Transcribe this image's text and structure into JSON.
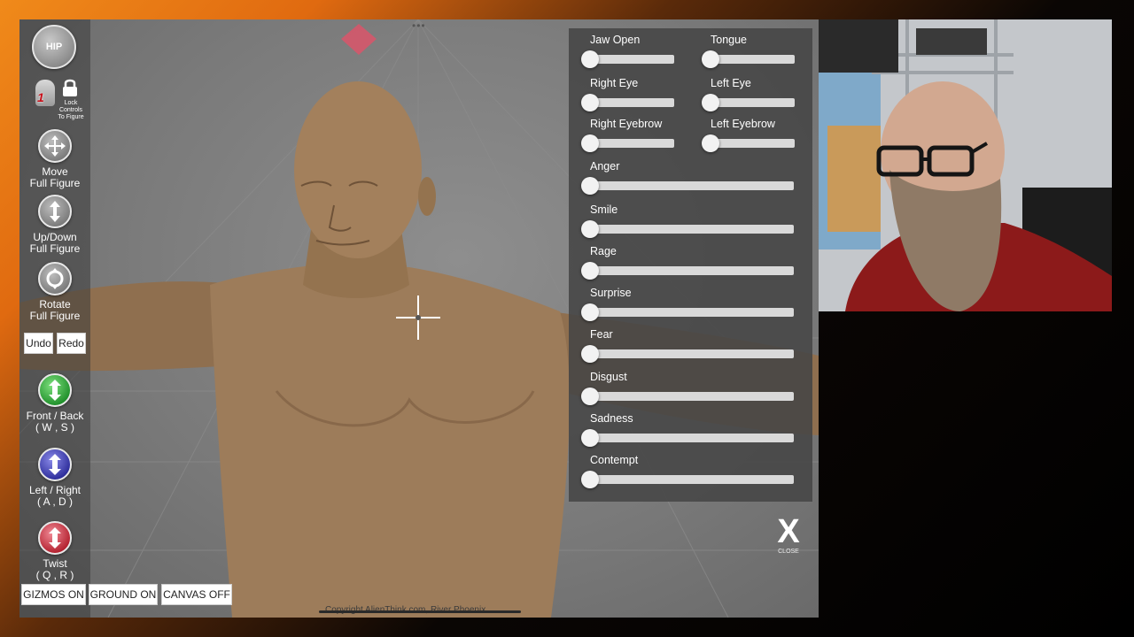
{
  "sidebar": {
    "hip_label": "HIP",
    "lock_label_line1": "Lock",
    "lock_label_line2": "Controls",
    "lock_label_line3": "To Figure",
    "figure_badge": "1",
    "move": {
      "line1": "Move",
      "line2": "Full Figure"
    },
    "updown": {
      "line1": "Up/Down",
      "line2": "Full Figure"
    },
    "rotate": {
      "line1": "Rotate",
      "line2": "Full Figure"
    },
    "undo": "Undo",
    "redo": "Redo",
    "frontback": {
      "line1": "Front / Back",
      "line2": "( W , S )"
    },
    "leftright": {
      "line1": "Left / Right",
      "line2": "( A , D )"
    },
    "twist": {
      "line1": "Twist",
      "line2": "( Q , R )"
    }
  },
  "bottom_bar": {
    "gizmos": "GIZMOS ON",
    "ground": "GROUND ON",
    "canvas": "CANVAS OFF"
  },
  "copyright": "Copyright AlienThink.com, River Phoenix",
  "top_dots": "•••",
  "expression_panel": {
    "paired_sliders": [
      {
        "left": {
          "label": "Jaw Open",
          "value": 0
        },
        "right": {
          "label": "Tongue",
          "value": 0
        }
      },
      {
        "left": {
          "label": "Right Eye",
          "value": 0
        },
        "right": {
          "label": "Left Eye",
          "value": 0
        }
      },
      {
        "left": {
          "label": "Right Eyebrow",
          "value": 0
        },
        "right": {
          "label": "Left Eyebrow",
          "value": 0
        }
      }
    ],
    "sliders": [
      {
        "label": "Anger",
        "value": 0
      },
      {
        "label": "Smile",
        "value": 0
      },
      {
        "label": "Rage",
        "value": 0
      },
      {
        "label": "Surprise",
        "value": 0
      },
      {
        "label": "Fear",
        "value": 0
      },
      {
        "label": "Disgust",
        "value": 0
      },
      {
        "label": "Sadness",
        "value": 0
      },
      {
        "label": "Contempt",
        "value": 0
      }
    ]
  },
  "close": {
    "symbol": "X",
    "label": "CLOSE"
  }
}
